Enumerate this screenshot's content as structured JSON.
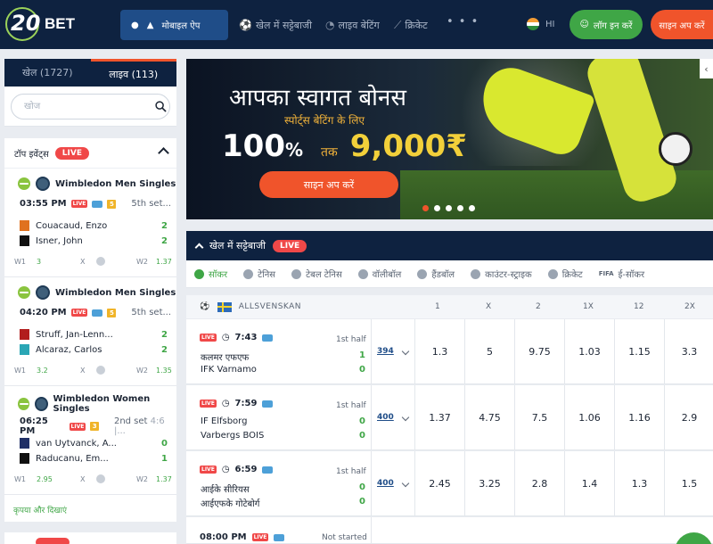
{
  "header": {
    "logo_num": "20",
    "logo_txt": "BET",
    "mobile_app": "मोबाइल ऐप",
    "nav": [
      "खेल में सट्टेबाजी",
      "लाइव बेटिंग",
      "क्रिकेट"
    ],
    "more_dots": "• • •",
    "lang": "HI",
    "login": "लॉग इन करें",
    "signup": "साइन अप करें"
  },
  "sidebar": {
    "tabs": [
      "खेल (1727)",
      "लाइव (113)"
    ],
    "search_placeholder": "खोज",
    "top_events_title": "टॉप इवेंट्स",
    "live_label": "LIVE",
    "events": [
      {
        "title": "Wimbledon Men Singles",
        "time": "03:55 PM",
        "n": "5",
        "set": "5th set...",
        "set_extra": "",
        "players": [
          {
            "name": "Couacaud, Enzo",
            "score": "2",
            "shirt": "#e0711f"
          },
          {
            "name": "Isner, John",
            "score": "2",
            "shirt": "#111111"
          }
        ],
        "w1_label": "W1",
        "w1": "3",
        "x_label": "X",
        "w2_label": "W2",
        "w2": "1.37"
      },
      {
        "title": "Wimbledon Men Singles",
        "time": "04:20 PM",
        "n": "5",
        "set": "5th set...",
        "set_extra": "",
        "players": [
          {
            "name": "Struff, Jan-Lenn...",
            "score": "2",
            "shirt": "#b21d1d"
          },
          {
            "name": "Alcaraz, Carlos",
            "score": "2",
            "shirt": "#2aa6b5"
          }
        ],
        "w1_label": "W1",
        "w1": "3.2",
        "x_label": "X",
        "w2_label": "W2",
        "w2": "1.35"
      },
      {
        "title": "Wimbledon Women Singles",
        "time": "06:25 PM",
        "n": "3",
        "set": "2nd set",
        "set_extra": "4:6 |...",
        "players": [
          {
            "name": "van Uytvanck, A...",
            "score": "0",
            "shirt": "#1f2f66"
          },
          {
            "name": "Raducanu, Em...",
            "score": "1",
            "shirt": "#111111"
          }
        ],
        "w1_label": "W1",
        "w1": "2.95",
        "x_label": "X",
        "w2_label": "W2",
        "w2": "1.37"
      }
    ],
    "show_more": "कृपया और दिखाएं"
  },
  "banner": {
    "title": "आपका स्वागत बोनस",
    "subtitle": "स्पोर्ट्स बेटिंग के लिए",
    "pct_num": "100",
    "pct_sym": "%",
    "upto": "तक",
    "amount": "9,000₹",
    "cta": "साइन अप करें",
    "arrow": "‹"
  },
  "sports": {
    "section_title": "खेल में सट्टेबाजी",
    "live_label": "LIVE",
    "tabs": [
      "सॉकर",
      "टेनिस",
      "टेबल टेनिस",
      "वॉलीबॉल",
      "हैंडबॉल",
      "काउंटर-स्ट्राइक",
      "क्रिकेट",
      "ई-सॉकर"
    ],
    "fifa_tag": "FIFA",
    "league": "ALLSVENSKAN",
    "columns": [
      "1",
      "X",
      "2",
      "1X",
      "12",
      "2X"
    ],
    "matches": [
      {
        "time": "7:43",
        "status": "1st half",
        "team1": "कलमर एफएफ",
        "team2": "IFK Varnamo",
        "s1": "1",
        "s2": "0",
        "more": "394",
        "odds": [
          "1.3",
          "5",
          "9.75",
          "1.03",
          "1.15",
          "3.3"
        ]
      },
      {
        "time": "7:59",
        "status": "1st half",
        "team1": "IF Elfsborg",
        "team2": "Varbergs BOIS",
        "s1": "0",
        "s2": "0",
        "more": "400",
        "odds": [
          "1.37",
          "4.75",
          "7.5",
          "1.06",
          "1.16",
          "2.9"
        ]
      },
      {
        "time": "6:59",
        "status": "1st half",
        "team1": "आईके सीरियस",
        "team2": "आईएफके गोटेबोर्ग",
        "s1": "0",
        "s2": "0",
        "more": "400",
        "odds": [
          "2.45",
          "3.25",
          "2.8",
          "1.4",
          "1.3",
          "1.5"
        ]
      }
    ],
    "next_match": {
      "time": "08:00 PM",
      "status": "Not started"
    }
  },
  "colors": {
    "navy": "#0e2240",
    "green": "#3fa646",
    "orange": "#f0542b",
    "live": "#f04848"
  }
}
